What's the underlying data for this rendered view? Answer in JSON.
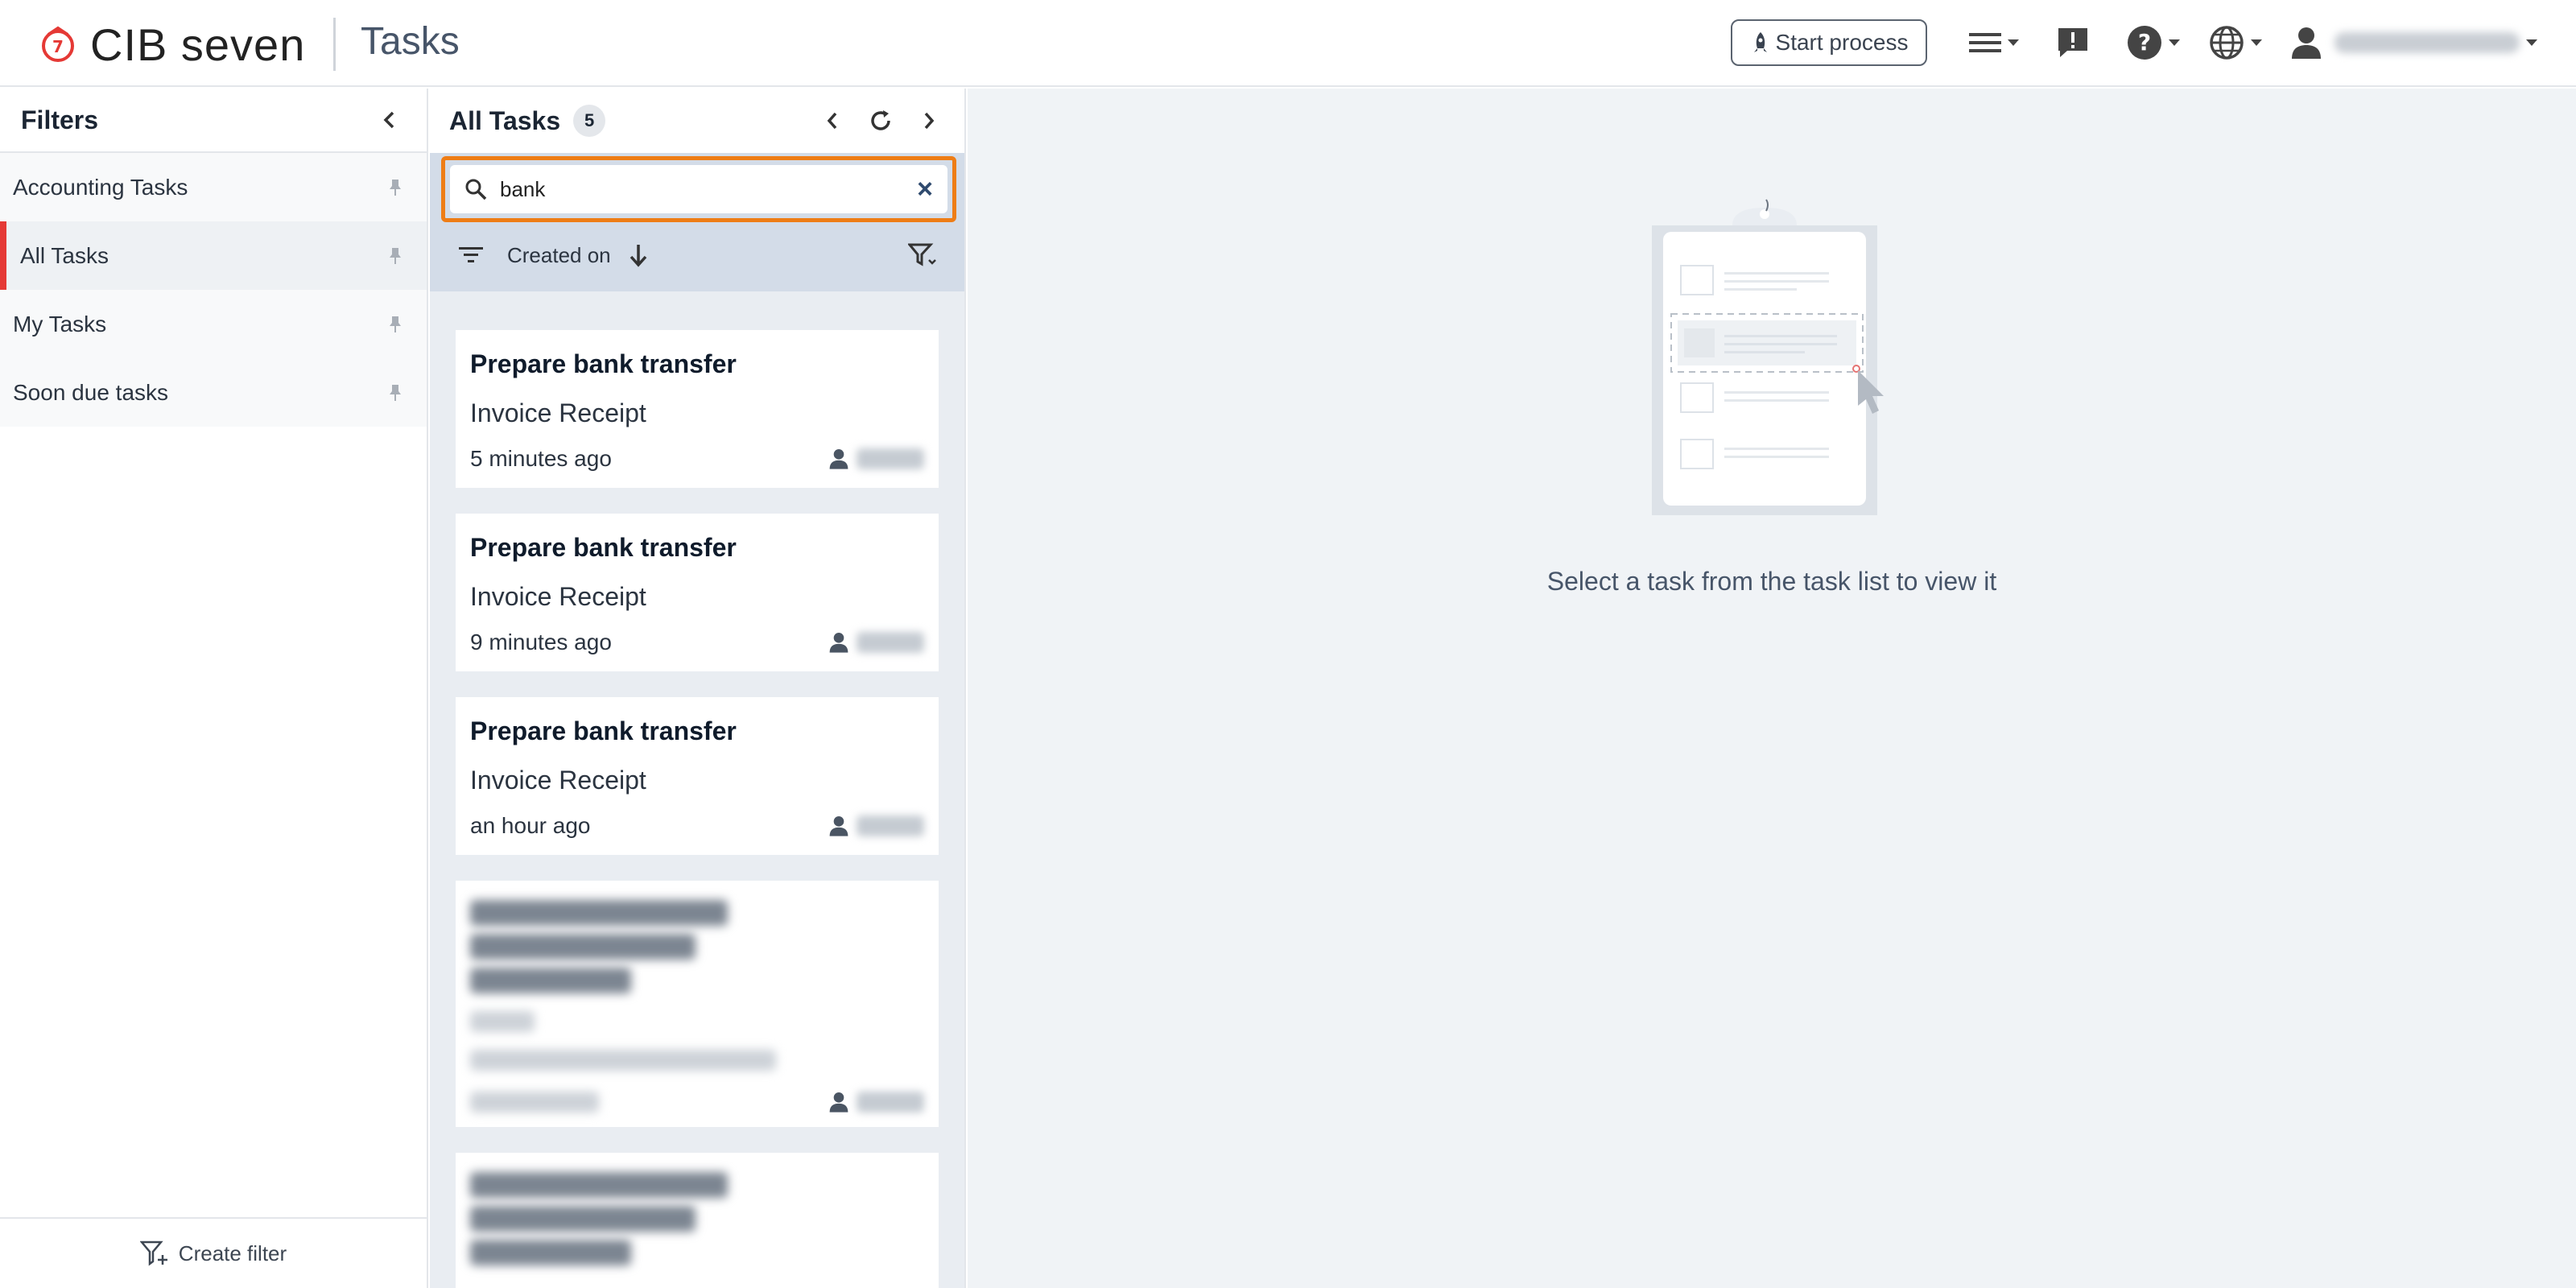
{
  "header": {
    "brand": "CIB seven",
    "app_title": "Tasks",
    "start_process_label": "Start process",
    "icons": [
      "menu-icon",
      "feedback-icon",
      "help-icon",
      "globe-icon",
      "user-icon"
    ],
    "accent_color": "#e53935"
  },
  "filters": {
    "title": "Filters",
    "items": [
      {
        "label": "Accounting Tasks",
        "active": false
      },
      {
        "label": "All Tasks",
        "active": true
      },
      {
        "label": "My Tasks",
        "active": false
      },
      {
        "label": "Soon due tasks",
        "active": false
      }
    ],
    "create_label": "Create filter"
  },
  "tasks": {
    "title": "All Tasks",
    "count": "5",
    "search_value": "bank",
    "sort_label": "Created on",
    "cards": [
      {
        "name": "Prepare bank transfer",
        "process": "Invoice Receipt",
        "time": "5 minutes ago"
      },
      {
        "name": "Prepare bank transfer",
        "process": "Invoice Receipt",
        "time": "9 minutes ago"
      },
      {
        "name": "Prepare bank transfer",
        "process": "Invoice Receipt",
        "time": "an hour ago"
      }
    ]
  },
  "detail": {
    "empty_text": "Select a task from the task list to view it"
  }
}
